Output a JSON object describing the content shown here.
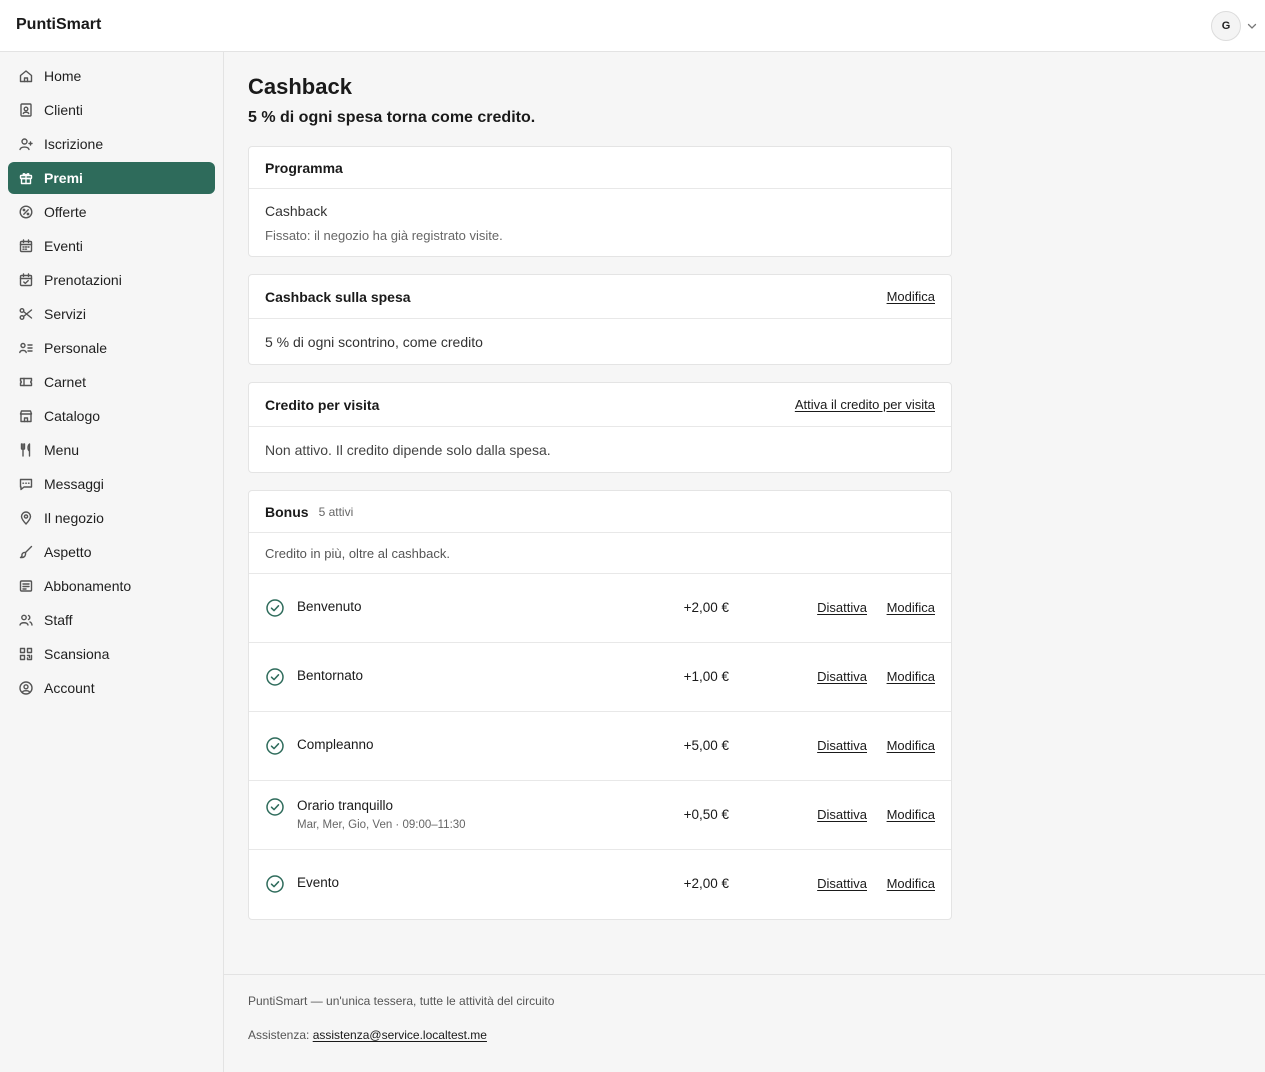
{
  "app": {
    "brand": "PuntiSmart",
    "user_initial": "G"
  },
  "sidebar": {
    "items": [
      {
        "label": "Home",
        "icon": "home-icon"
      },
      {
        "label": "Clienti",
        "icon": "contacts-icon"
      },
      {
        "label": "Iscrizione",
        "icon": "user-plus-icon"
      },
      {
        "label": "Premi",
        "icon": "gift-icon",
        "active": true
      },
      {
        "label": "Offerte",
        "icon": "percent-badge-icon"
      },
      {
        "label": "Eventi",
        "icon": "calendar-icon"
      },
      {
        "label": "Prenotazioni",
        "icon": "calendar-check-icon"
      },
      {
        "label": "Servizi",
        "icon": "scissors-icon"
      },
      {
        "label": "Personale",
        "icon": "staff-list-icon"
      },
      {
        "label": "Carnet",
        "icon": "ticket-icon"
      },
      {
        "label": "Catalogo",
        "icon": "store-icon"
      },
      {
        "label": "Menu",
        "icon": "utensils-icon"
      },
      {
        "label": "Messaggi",
        "icon": "message-icon"
      },
      {
        "label": "Il negozio",
        "icon": "map-pin-icon"
      },
      {
        "label": "Aspetto",
        "icon": "brush-icon"
      },
      {
        "label": "Abbonamento",
        "icon": "receipt-icon"
      },
      {
        "label": "Staff",
        "icon": "users-icon"
      },
      {
        "label": "Scansiona",
        "icon": "qr-icon"
      },
      {
        "label": "Account",
        "icon": "user-circle-icon"
      }
    ]
  },
  "page": {
    "title": "Cashback",
    "subtitle": "5 % di ogni spesa torna come credito."
  },
  "program": {
    "title": "Programma",
    "value": "Cashback",
    "note": "Fissato: il negozio ha già registrato visite."
  },
  "cashback": {
    "title": "Cashback sulla spesa",
    "action": "Modifica",
    "text": "5 % di ogni scontrino, come credito"
  },
  "visit_credit": {
    "title": "Credito per visita",
    "action": "Attiva il credito per visita",
    "text": "Non attivo. Il credito dipende solo dalla spesa."
  },
  "bonus": {
    "title": "Bonus",
    "count": "5 attivi",
    "description": "Credito in più, oltre al cashback.",
    "disable_label": "Disattiva",
    "edit_label": "Modifica",
    "items": [
      {
        "name": "Benvenuto",
        "amount": "+2,00 €",
        "detail": ""
      },
      {
        "name": "Bentornato",
        "amount": "+1,00 €",
        "detail": ""
      },
      {
        "name": "Compleanno",
        "amount": "+5,00 €",
        "detail": ""
      },
      {
        "name": "Orario tranquillo",
        "amount": "+0,50 €",
        "detail": "Mar, Mer, Gio, Ven · 09:00–11:30"
      },
      {
        "name": "Evento",
        "amount": "+2,00 €",
        "detail": ""
      }
    ]
  },
  "footer": {
    "tagline": "PuntiSmart — un'unica tessera, tutte le attività del circuito",
    "support_label": "Assistenza:",
    "support_email": "assistenza@service.localtest.me"
  },
  "colors": {
    "accent": "#2e6b5b"
  }
}
